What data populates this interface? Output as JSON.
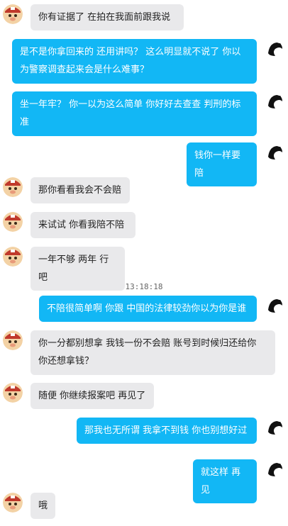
{
  "colors": {
    "outgoing_bubble": "#12b7f5",
    "incoming_bubble": "#e9e9eb",
    "outgoing_text": "#ffffff",
    "incoming_text": "#222222"
  },
  "icons": {
    "contact_avatar": "pig-avatar",
    "self_avatar": "black-dragon-avatar"
  },
  "timestamp": "13:18:18",
  "messages": [
    {
      "from": "contact",
      "text": "你有证据了 在拍在我面前跟我说"
    },
    {
      "from": "me",
      "text": "是不是你拿回来的 还用讲吗？  这么明显就不说了  你以为警察调查起来会是什么难事？"
    },
    {
      "from": "me",
      "text": "坐一年牢？  你一以为这么简单  你好好去查查  判刑的标准"
    },
    {
      "from": "me",
      "text": "钱你一样要陪"
    },
    {
      "from": "contact",
      "text": "那你看看我会不会赔"
    },
    {
      "from": "contact",
      "text": "来试试  你看我陪不陪"
    },
    {
      "from": "contact",
      "text": "一年不够  两年  行吧"
    },
    {
      "from": "me",
      "text": "不陪很简单啊  你跟 中国的法律较劲你以为你是谁"
    },
    {
      "from": "contact",
      "text": "你一分都别想拿  我钱一份不会赔   账号到时候归还给你  你还想拿钱？"
    },
    {
      "from": "contact",
      "text": "随便  你继续报案吧  再见了"
    },
    {
      "from": "me",
      "text": "那我也无所谓  我拿不到钱  你也别想好过"
    },
    {
      "from": "me",
      "text": "就这样  再见"
    },
    {
      "from": "contact",
      "text": "哦"
    }
  ]
}
